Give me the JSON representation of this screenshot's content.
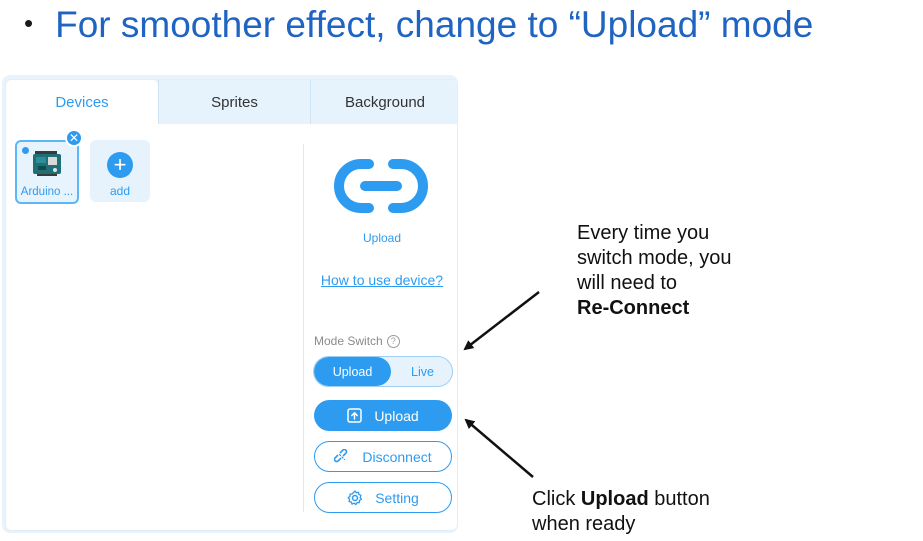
{
  "slide": {
    "bullet": "•",
    "heading": "For smoother effect, change to “Upload” mode"
  },
  "tabs": [
    {
      "label": "Devices",
      "active": true
    },
    {
      "label": "Sprites",
      "active": false
    },
    {
      "label": "Background",
      "active": false
    }
  ],
  "devices": {
    "arduino_label": "Arduino ...",
    "close_symbol": "✕",
    "add_symbol": "+",
    "add_label": "add"
  },
  "device_panel": {
    "mode_icon": "link-icon",
    "mode_label": "Upload",
    "howto_link": "How to use device?",
    "mode_switch_label": "Mode Switch",
    "help_symbol": "?",
    "toggle": {
      "upload": "Upload",
      "live": "Live",
      "selected": "Upload"
    },
    "upload_button": "Upload",
    "disconnect_button": "Disconnect",
    "setting_button": "Setting"
  },
  "annotations": {
    "note1_lines": [
      "Every time you",
      "switch mode, you",
      "will need to"
    ],
    "note1_bold": "Re-Connect",
    "note2_prefix": "Click ",
    "note2_bold": "Upload",
    "note2_suffix": " button",
    "note2_line2": "when ready"
  },
  "colors": {
    "accent": "#2d9cf0",
    "heading": "#1f64c2",
    "tab_bar": "#e6f2fc"
  }
}
